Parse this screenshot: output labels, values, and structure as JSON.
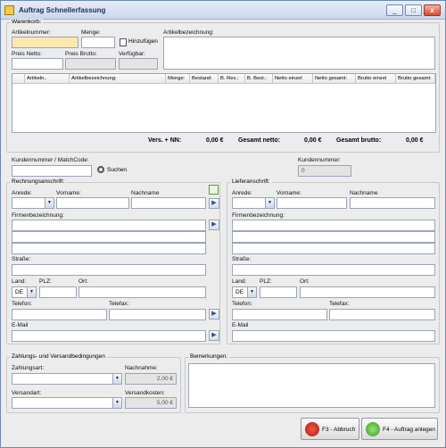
{
  "window": {
    "title": "Auftrag Schnellerfassung",
    "min": "_",
    "max": "□",
    "close": "x"
  },
  "basket": {
    "legend": "Warenkorb:",
    "artnr_label": "Artikelnummer:",
    "menge_label": "Menge:",
    "hinzufuegen": "Hinzufügen",
    "bez_label": "Artikelbezeichnung:",
    "preis_netto_label": "Preis Netto:",
    "preis_brutto_label": "Preis Brutto:",
    "verfuegbar_label": "Verfügbar:"
  },
  "grid": {
    "columns": [
      "Artikeln..",
      "Artikelbezeichnung:",
      "Menge:",
      "Bestand:",
      "B. Res.:",
      "B. Best.:",
      "Netto einzel",
      "Netto gesamt:",
      "Brutto einzel",
      "Brutto gesamt:"
    ]
  },
  "totals": {
    "vers_label": "Vers. + NN:",
    "vers_value": "0,00 €",
    "netto_label": "Gesamt netto:",
    "netto_value": "0,00 €",
    "brutto_label": "Gesamt brutto:",
    "brutto_value": "0,00 €"
  },
  "customer": {
    "match_label": "Kundennummer / MatchCode:",
    "suchen": "Suchen",
    "kundennr_label": "Kundennummer:",
    "kundennr_value": "0"
  },
  "rechnung": {
    "legend": "Rechnungsanschrift:",
    "anrede": "Anrede:",
    "vorname": "Vorname:",
    "nachname": "Nachname",
    "firma": "Firmenbezeichnung:",
    "strasse": "Straße:",
    "land": "Land:",
    "plz": "PLZ:",
    "ort": "Ort:",
    "land_value": "DE",
    "telefon": "Telefon:",
    "telefax": "Telefax:",
    "email": "E-Mail"
  },
  "liefer": {
    "legend": "Lieferanschrift:",
    "anrede": "Anrede:",
    "vorname": "Vorname:",
    "nachname": "Nachname",
    "firma": "Firmenbezeichnung:",
    "strasse": "Straße:",
    "land": "Land:",
    "plz": "PLZ:",
    "ort": "Ort:",
    "land_value": "DE",
    "telefon": "Telefon:",
    "telefax": "Telefax:",
    "email": "E-Mail"
  },
  "zahlung": {
    "legend": "Zahlungs- und Versandbedingungen",
    "zahlungsart": "Zahlungsart:",
    "nachnahme": "Nachnahme:",
    "nachnahme_value": "2,00 €",
    "versandart": "Versandart:",
    "versandkosten": "Versandkosten:",
    "versandkosten_value": "5,00 €"
  },
  "bemerkungen": {
    "legend": "Bemerkungen:"
  },
  "actions": {
    "abbruch": "F3 - Abbruch",
    "anlegen": "F4 - Auftrag anlegen"
  },
  "colors": {
    "title_text": "#1c2f55",
    "highlight": "#fde8b0"
  }
}
